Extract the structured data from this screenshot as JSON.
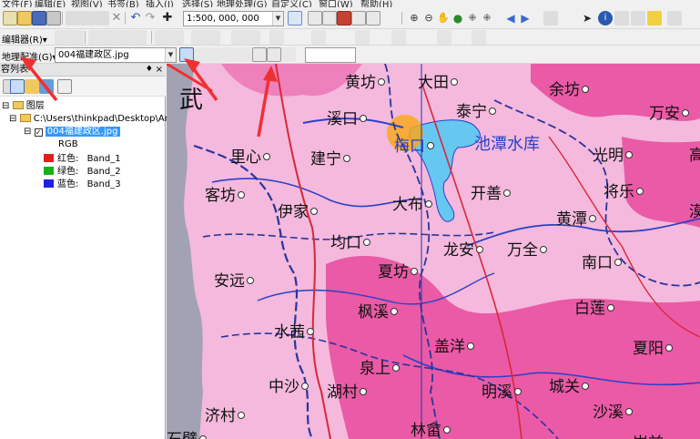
{
  "menu": [
    "文件(F)",
    "编辑(E)",
    "视图(V)",
    "书签(B)",
    "插入(I)",
    "选择(S)",
    "地理处理(G)",
    "自定义(C)",
    "窗口(W)",
    "帮助(H)"
  ],
  "toolbar": {
    "scale_value": "1:500, 000, 000",
    "editor_label": "编辑器(R)▾",
    "georef_label": "地理配准(G)▾",
    "georef_layer": "004福建政区.jpg"
  },
  "toc": {
    "title": "容列表",
    "pin": "♦ ×",
    "layers_label": "图层",
    "path": "C:\\Users\\thinkpad\\Desktop\\ArcG",
    "layer_name": "004福建政区.jpg",
    "rgb": "RGB",
    "bands": [
      {
        "label": "红色:",
        "band": "Band_1",
        "color": "#e0201e"
      },
      {
        "label": "绿色:",
        "band": "Band_2",
        "color": "#18b018"
      },
      {
        "label": "蓝色:",
        "band": "Band_3",
        "color": "#2020e0"
      }
    ]
  },
  "map": {
    "water_label": "池潭水库",
    "cities": [
      {
        "name": "黄坊"
      },
      {
        "name": "大田"
      },
      {
        "name": "余坊"
      },
      {
        "name": "溪口"
      },
      {
        "name": "泰宁"
      },
      {
        "name": "万安"
      },
      {
        "name": "武"
      },
      {
        "name": "梅口"
      },
      {
        "name": "里心"
      },
      {
        "name": "建宁"
      },
      {
        "name": "光明"
      },
      {
        "name": "高"
      },
      {
        "name": "客坊"
      },
      {
        "name": "开善"
      },
      {
        "name": "将乐"
      },
      {
        "name": "伊家"
      },
      {
        "name": "大布"
      },
      {
        "name": "黄潭"
      },
      {
        "name": "漠"
      },
      {
        "name": "均口"
      },
      {
        "name": "龙安"
      },
      {
        "name": "万全"
      },
      {
        "name": "南口"
      },
      {
        "name": "安远"
      },
      {
        "name": "夏坊"
      },
      {
        "name": "枫溪"
      },
      {
        "name": "白莲"
      },
      {
        "name": "水茜"
      },
      {
        "name": "盖洋"
      },
      {
        "name": "夏阳"
      },
      {
        "name": "泉上"
      },
      {
        "name": "中沙"
      },
      {
        "name": "湖村"
      },
      {
        "name": "明溪"
      },
      {
        "name": "城关"
      },
      {
        "name": "济村"
      },
      {
        "name": "沙溪"
      },
      {
        "name": "石壁"
      },
      {
        "name": "林畲"
      },
      {
        "name": "岩前"
      }
    ]
  },
  "colors": {
    "map_bg": "#f4b9dc",
    "region_dark": "#ea5aa6",
    "river": "#2b40c8",
    "lake": "#66c7f0",
    "boundary": "#27359e",
    "highlight": "#f7a820",
    "arrow": "#f03030",
    "selection": "#3399ff"
  }
}
